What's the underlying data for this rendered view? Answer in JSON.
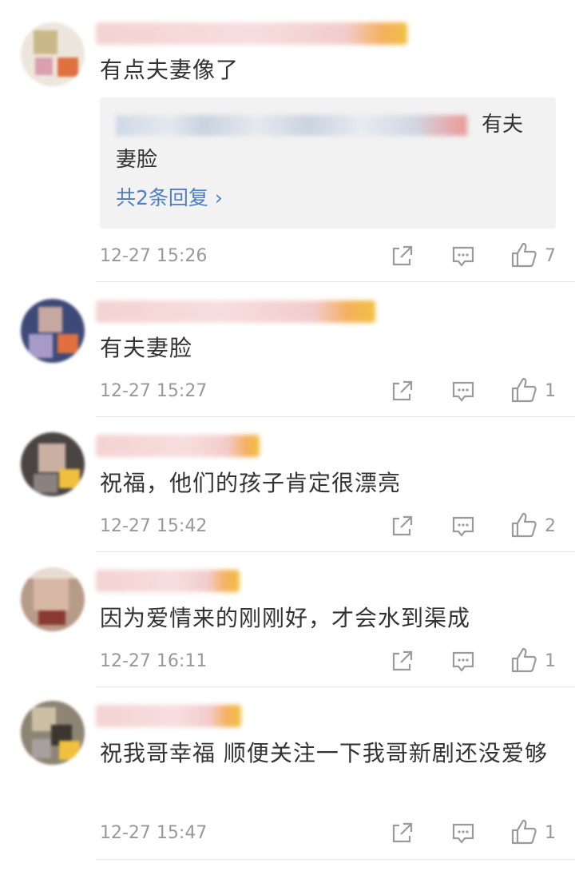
{
  "comments": [
    {
      "text": "有点夫妻像了",
      "reply": {
        "text_tail": "有夫",
        "text_line2": "妻脸",
        "count_label": "共2条回复 ›"
      },
      "time": "12-27 15:26",
      "likes": "7"
    },
    {
      "text": "有夫妻脸",
      "time": "12-27 15:27",
      "likes": "1"
    },
    {
      "text": "祝福，他们的孩子肯定很漂亮",
      "time": "12-27 15:42",
      "likes": "2"
    },
    {
      "text": "因为爱情来的刚刚好，才会水到渠成",
      "time": "12-27 16:11",
      "likes": "1"
    },
    {
      "text": "祝我哥幸福 顺便关注一下我哥新剧还没爱够",
      "time": "12-27 15:47",
      "likes": "1"
    }
  ],
  "colors": {
    "link": "#4b7fc1",
    "meta": "#999999",
    "reply_bg": "#f2f2f2",
    "icon": "#9a9a9a"
  },
  "icons": [
    "share-icon",
    "comment-icon",
    "like-icon"
  ]
}
